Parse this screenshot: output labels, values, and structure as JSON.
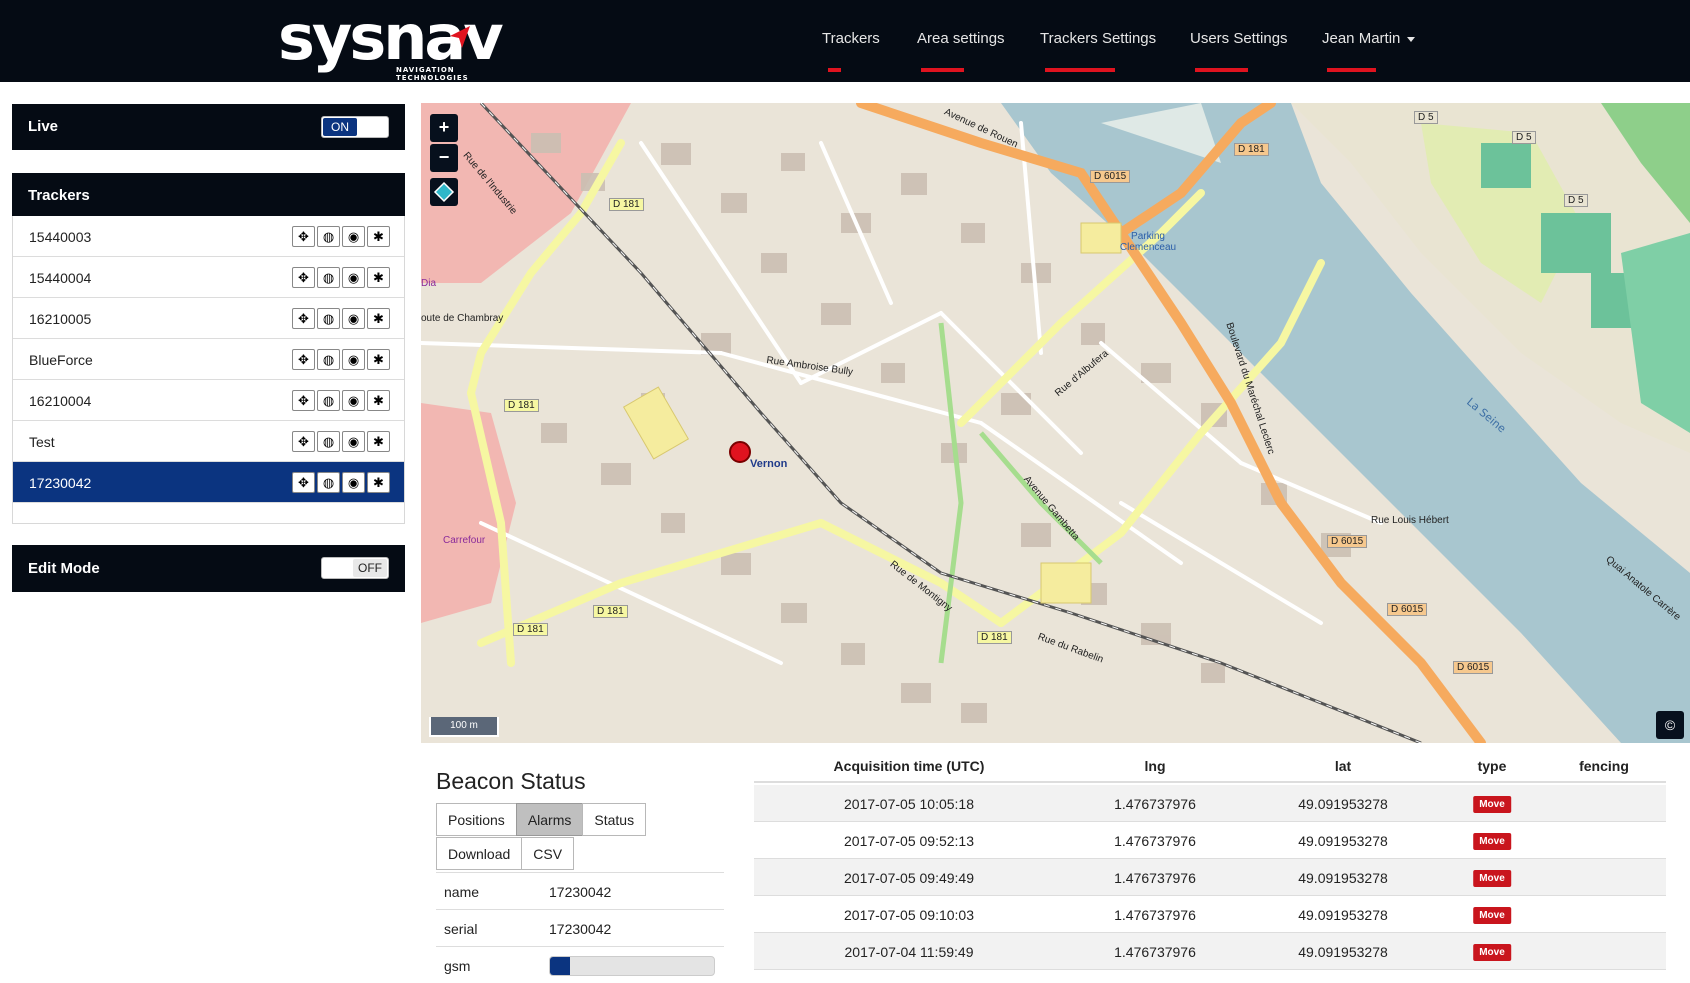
{
  "brand": {
    "name": "sysnav",
    "tagline": "NAVIGATION TECHNOLOGIES"
  },
  "nav": {
    "items": [
      {
        "label": "Trackers"
      },
      {
        "label": "Area settings"
      },
      {
        "label": "Trackers Settings"
      },
      {
        "label": "Users Settings"
      },
      {
        "label": "Jean Martin"
      }
    ]
  },
  "live": {
    "label": "Live",
    "state": "ON"
  },
  "trackers": {
    "title": "Trackers",
    "items": [
      {
        "name": "15440003"
      },
      {
        "name": "15440004"
      },
      {
        "name": "16210005"
      },
      {
        "name": "BlueForce"
      },
      {
        "name": "16210004"
      },
      {
        "name": "Test"
      },
      {
        "name": "17230042",
        "selected": true
      }
    ]
  },
  "edit_mode": {
    "label": "Edit Mode",
    "state": "OFF"
  },
  "map": {
    "zoom_in": "+",
    "zoom_out": "−",
    "scale_label": "100 m",
    "attribution": "©",
    "town_label": "Vernon",
    "river_label": "La Seine",
    "labels": {
      "d181_a": "D 181",
      "d181_b": "D 181",
      "d181_c": "D 181",
      "d181_d": "D 181",
      "d181_e": "D 181",
      "d181_f": "D 181",
      "d6015_a": "D 6015",
      "d6015_b": "D 6015",
      "d6015_c": "D 6015",
      "d6015_d": "D 6015",
      "d5_a": "D 5",
      "d5_b": "D 5",
      "d5_c": "D 5",
      "avenue_rouen": "Avenue de Rouen",
      "rue_montigny": "Rue de Montigny",
      "boulevard_leclerc": "Boulevard du Maréchal Leclerc",
      "avenue_gambetta": "Avenue Gambetta",
      "rue_albufera": "Rue d'Albufera",
      "rue_industrie": "Rue de l'Industrie",
      "parking": "Parking Clemenceau",
      "carrefour": "Carrefour",
      "dia": "Dia",
      "route_chambray": "oute de Chambray",
      "rue_louis_hebert": "Rue Louis Hébert",
      "quai_anatole": "Quai Anatole Carrère",
      "rue_ambroise": "Rue Ambroise Bully",
      "rue_du_rabelin": "Rue du Rabelin"
    }
  },
  "beacon": {
    "title": "Beacon Status",
    "tabs": [
      {
        "label": "Positions"
      },
      {
        "label": "Alarms",
        "active": true
      },
      {
        "label": "Status"
      }
    ],
    "actions": [
      {
        "label": "Download"
      },
      {
        "label": "CSV"
      }
    ],
    "name_label": "name",
    "name_value": "17230042",
    "serial_label": "serial",
    "serial_value": "17230042",
    "gsm_label": "gsm",
    "gsm_level": 0.12
  },
  "table": {
    "headers": {
      "time": "Acquisition time (UTC)",
      "lng": "lng",
      "lat": "lat",
      "type": "type",
      "fencing": "fencing"
    },
    "rows": [
      {
        "time": "2017-07-05 10:05:18",
        "lng": "1.476737976",
        "lat": "49.091953278",
        "type": "Move"
      },
      {
        "time": "2017-07-05 09:52:13",
        "lng": "1.476737976",
        "lat": "49.091953278",
        "type": "Move"
      },
      {
        "time": "2017-07-05 09:49:49",
        "lng": "1.476737976",
        "lat": "49.091953278",
        "type": "Move"
      },
      {
        "time": "2017-07-05 09:10:03",
        "lng": "1.476737976",
        "lat": "49.091953278",
        "type": "Move"
      },
      {
        "time": "2017-07-04 11:59:49",
        "lng": "1.476737976",
        "lat": "49.091953278",
        "type": "Move"
      }
    ]
  }
}
